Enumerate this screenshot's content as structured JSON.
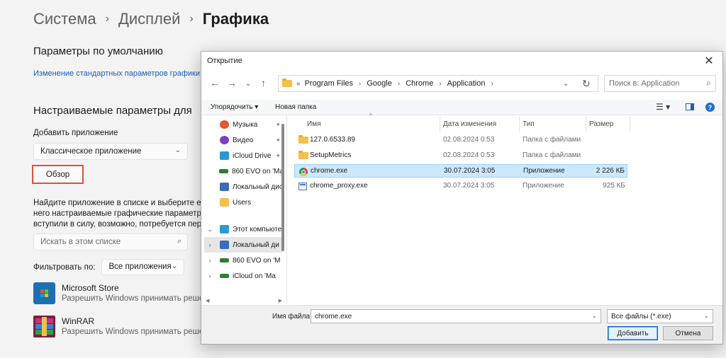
{
  "settings": {
    "breadcrumb": [
      "Система",
      "Дисплей",
      "Графика"
    ],
    "defaults_heading": "Параметры по умолчанию",
    "defaults_link": "Изменение стандартных параметров графики",
    "custom_heading": "Настраиваемые параметры для",
    "add_app_label": "Добавить приложение",
    "app_type_value": "Классическое приложение",
    "browse_button": "Обзор",
    "description_lines": [
      "Найдите приложение в списке и выберите его,",
      "него настраиваемые графические параметры.",
      "вступили в силу, возможно, потребуется перез"
    ],
    "search_placeholder": "Искать в этом списке",
    "filter_label": "Фильтровать по:",
    "filter_value": "Все приложения",
    "apps": [
      {
        "name": "Microsoft Store",
        "subtitle": "Разрешить Windows принимать решен",
        "icon": "microsoft-store-icon"
      },
      {
        "name": "WinRAR",
        "subtitle": "Разрешить Windows принимать решен",
        "icon": "winrar-icon"
      }
    ]
  },
  "dialog": {
    "title": "Открытие",
    "address": {
      "prefix": "«",
      "crumbs": [
        "Program Files",
        "Google",
        "Chrome",
        "Application"
      ]
    },
    "search_placeholder": "Поиск в: Application",
    "toolbar": {
      "organize": "Упорядочить ▾",
      "new_folder": "Новая папка"
    },
    "nav_items": [
      {
        "label": "Музыка",
        "icon": "music-icon",
        "color": "#e8552e",
        "pinned": true
      },
      {
        "label": "Видео",
        "icon": "video-icon",
        "color": "#7b3fc4",
        "pinned": true
      },
      {
        "label": "iCloud Drive",
        "icon": "icloud-drive-icon",
        "color": "#2a9ad6",
        "pinned": true
      },
      {
        "label": "860 EVO on 'Ma",
        "icon": "drive-icon",
        "color": "#2e7d32",
        "pinned": false
      },
      {
        "label": "Локальный дис",
        "icon": "local-disk-icon",
        "color": "#3a6db5",
        "pinned": false
      },
      {
        "label": "Users",
        "icon": "folder-icon",
        "color": "#f2c14e",
        "pinned": false
      },
      {
        "label": "Этот компьюте",
        "icon": "computer-icon",
        "color": "#2a9ad6",
        "pinned": false
      },
      {
        "label": "Локальный ди",
        "icon": "local-disk-icon",
        "color": "#3a6db5",
        "pinned": false
      },
      {
        "label": "860 EVO on 'M",
        "icon": "drive-icon",
        "color": "#2e7d32",
        "pinned": false
      },
      {
        "label": "iCloud on 'Ma",
        "icon": "drive-icon",
        "color": "#2e7d32",
        "pinned": false
      }
    ],
    "columns": [
      "Имя",
      "Дата изменения",
      "Тип",
      "Размер"
    ],
    "files": [
      {
        "name": "127.0.6533.89",
        "date": "02.08.2024 0:53",
        "type": "Папка с файлами",
        "size": "",
        "icon": "folder-icon"
      },
      {
        "name": "SetupMetrics",
        "date": "02.08.2024 0:53",
        "type": "Папка с файлами",
        "size": "",
        "icon": "folder-icon"
      },
      {
        "name": "chrome.exe",
        "date": "30.07.2024 3:05",
        "type": "Приложение",
        "size": "2 226 КБ",
        "icon": "chrome-icon",
        "selected": true
      },
      {
        "name": "chrome_proxy.exe",
        "date": "30.07.2024 3:05",
        "type": "Приложение",
        "size": "925 КБ",
        "icon": "exe-icon"
      }
    ],
    "filename_label": "Имя файла:",
    "filename_value": "chrome.exe",
    "filetype_value": "Все файлы (*.exe)",
    "open_button": "Добавить",
    "cancel_button": "Отмена"
  }
}
